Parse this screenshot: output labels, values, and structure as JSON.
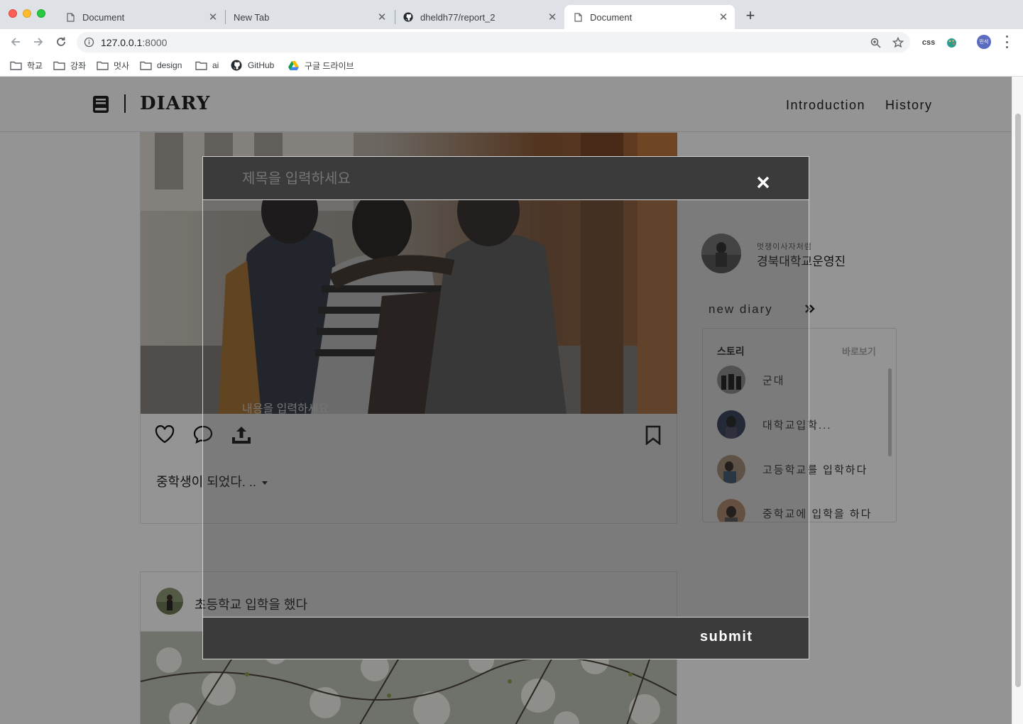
{
  "browser": {
    "tabs": [
      {
        "title": "Document"
      },
      {
        "title": "New Tab"
      },
      {
        "title": "dheldh77/report_2"
      },
      {
        "title": "Document"
      }
    ],
    "address": {
      "host": "127.0.0.1",
      "port": ":8000"
    },
    "extensions": {
      "css_label": "css"
    },
    "profile_initials": "민석",
    "bookmarks": [
      {
        "label": "학교"
      },
      {
        "label": "강좌"
      },
      {
        "label": "멋사"
      },
      {
        "label": "design"
      },
      {
        "label": "ai"
      },
      {
        "label": "GitHub"
      },
      {
        "label": "구글 드라이브"
      }
    ]
  },
  "site": {
    "logo": "DIARY",
    "nav": [
      {
        "label": "Introduction"
      },
      {
        "label": "History"
      }
    ]
  },
  "post": {
    "caption": "중학생이 되었다. .."
  },
  "post2": {
    "title": "초등학교 입학을 했다"
  },
  "profile": {
    "subtitle": "멋쟁이사자처럼",
    "name": "경북대학교운영진"
  },
  "sidebar": {
    "new_diary": "new diary",
    "story_title": "스토리",
    "story_more": "바로보기",
    "stories": [
      {
        "text": "군대"
      },
      {
        "text": "대학교입학..."
      },
      {
        "text": "고등학교를 입학하다"
      },
      {
        "text": "중학교에 입학을 하다"
      }
    ]
  },
  "modal": {
    "title_placeholder": "제목을 입력하세요",
    "content_placeholder": "내용을 입력하세요",
    "submit_label": "submit"
  },
  "colors": {
    "modal_bar": "#3b3b3b",
    "overlay": "rgba(0,0,0,0.42)",
    "tabbar": "#dee1e6"
  }
}
